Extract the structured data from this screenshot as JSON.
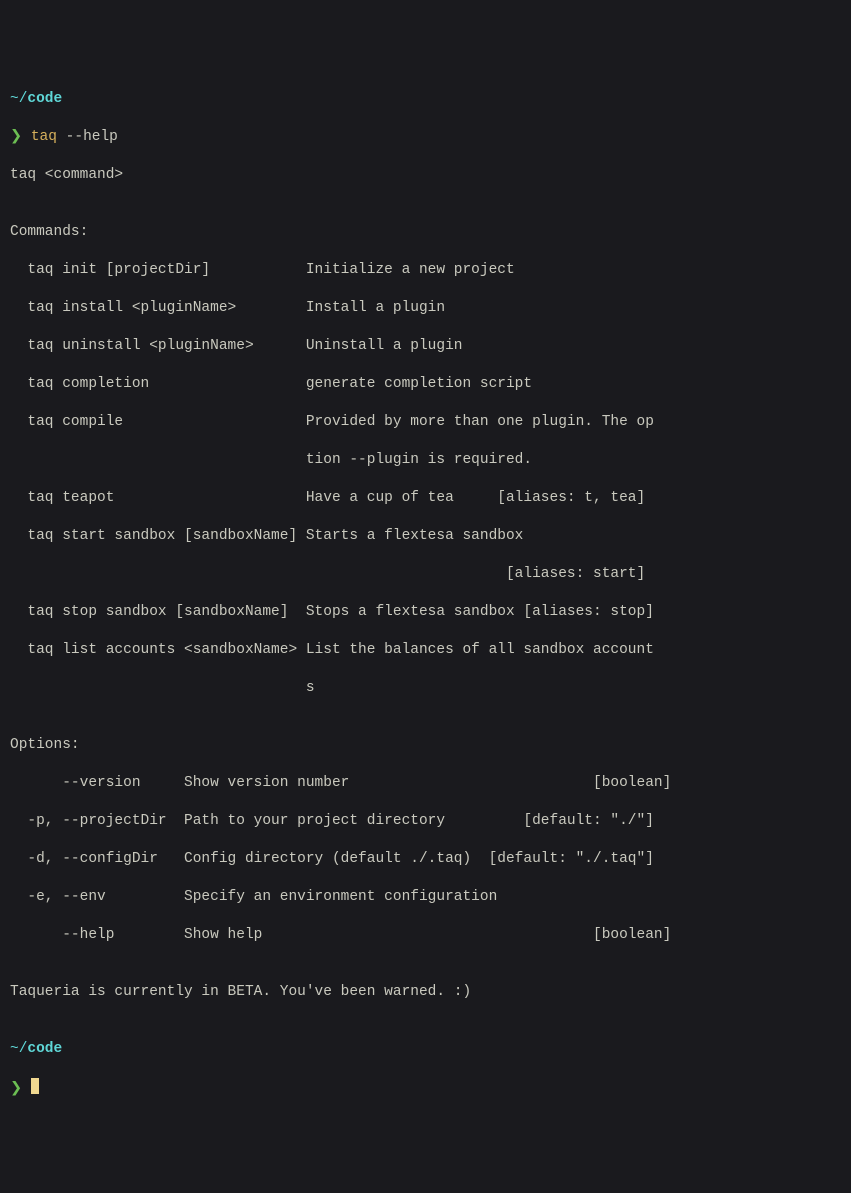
{
  "tilde1": "~/",
  "cwd1": "code",
  "prompt1": "❯ ",
  "cmd1": "taq ",
  "flag1": "--help",
  "out": {
    "usage": "taq <command>",
    "blank1": "",
    "cmdhdr": "Commands:",
    "c1": "  taq init [projectDir]           Initialize a new project",
    "c2": "  taq install <pluginName>        Install a plugin",
    "c3": "  taq uninstall <pluginName>      Uninstall a plugin",
    "c4": "  taq completion                  generate completion script",
    "c5": "  taq compile                     Provided by more than one plugin. The op",
    "c5b": "                                  tion --plugin is required.",
    "c6": "  taq teapot                      Have a cup of tea     [aliases: t, tea]",
    "c7": "  taq start sandbox [sandboxName] Starts a flextesa sandbox",
    "c7b": "                                                         [aliases: start]",
    "c8": "  taq stop sandbox [sandboxName]  Stops a flextesa sandbox [aliases: stop]",
    "c9": "  taq list accounts <sandboxName> List the balances of all sandbox account",
    "c9b": "                                  s",
    "blank2": "",
    "opthdr": "Options:",
    "o1": "      --version     Show version number                            [boolean]",
    "o2": "  -p, --projectDir  Path to your project directory         [default: \"./\"]",
    "o3": "  -d, --configDir   Config directory (default ./.taq)  [default: \"./.taq\"]",
    "o4": "  -e, --env         Specify an environment configuration",
    "o5": "      --help        Show help                                      [boolean]",
    "blank3": "",
    "beta": "Taqueria is currently in BETA. You've been warned. :)",
    "blank4": ""
  },
  "tilde2": "~/",
  "cwd2": "code",
  "prompt2": "❯ "
}
